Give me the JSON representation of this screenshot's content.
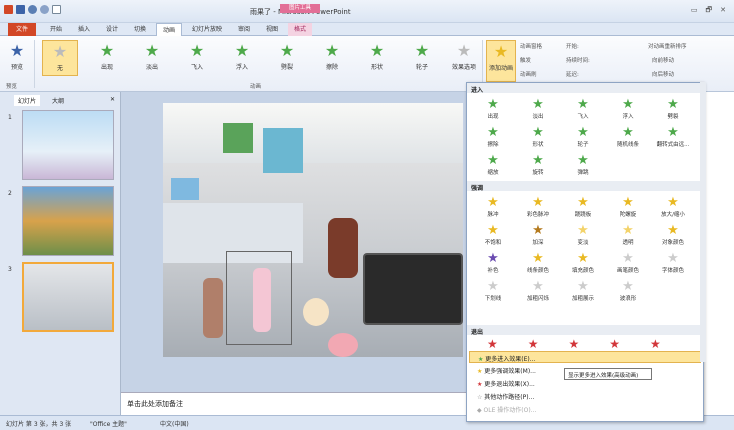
{
  "titlebar": {
    "title": "雨果了 - Microsoft PowerPoint",
    "picture_tools": "图片工具",
    "controls": [
      "▭",
      "🗗",
      "✕"
    ]
  },
  "tabs": [
    "文件",
    "开始",
    "插入",
    "设计",
    "切换",
    "动画",
    "幻灯片放映",
    "审阅",
    "视图",
    "格式"
  ],
  "ribbon": {
    "preview": "预览",
    "preview_group": "预览",
    "animation_group": "动画",
    "animations": [
      "无",
      "出现",
      "淡出",
      "飞入",
      "浮入",
      "劈裂",
      "擦除",
      "形状",
      "轮子"
    ],
    "effect_options": "效果选项",
    "add_animation": "添加动画",
    "pane": "动画窗格",
    "trigger": "触发",
    "painter": "动画刷",
    "start": "开始:",
    "duration": "持续时间:",
    "delay": "延迟:",
    "reorder": "对动画重新排序",
    "move_earlier": "向前移动",
    "move_later": "向后移动"
  },
  "panel": {
    "tab_slides": "幻灯片",
    "tab_outline": "大纲",
    "close": "✕",
    "slide_numbers": [
      "1",
      "2",
      "3"
    ]
  },
  "notes": "单击此处添加备注",
  "status": {
    "slide": "幻灯片 第 3 张，共 3 张",
    "theme": "\"Office 主题\"",
    "lang": "中文(中国)"
  },
  "gallery": {
    "sec_enter": "进入",
    "enter": [
      "出现",
      "淡出",
      "飞入",
      "浮入",
      "劈裂",
      "擦除",
      "形状",
      "轮子",
      "随机线条",
      "翻转式由远...",
      "缩放",
      "旋转",
      "弹跳"
    ],
    "sec_emph": "强调",
    "emph": [
      "脉冲",
      "彩色脉冲",
      "跷跷板",
      "陀螺旋",
      "放大/缩小",
      "不饱和",
      "加深",
      "变淡",
      "透明",
      "对象颜色",
      "补色",
      "线条颜色",
      "填充颜色",
      "画笔颜色",
      "字体颜色",
      "下划线",
      "加粗闪烁",
      "加粗展示",
      "波浪形"
    ],
    "sec_exit": "退出",
    "menu": [
      "更多进入效果(E)...",
      "更多强调效果(M)...",
      "更多退出效果(X)...",
      "其他动作路径(P)...",
      "OLE 操作动作(O)..."
    ]
  },
  "tooltip": "显示更多进入效果(高级动画)",
  "colors": {
    "accent": "#d24726",
    "green_star": "#4ea94b",
    "gold_star": "#e9b923",
    "highlight": "#fde59c"
  }
}
